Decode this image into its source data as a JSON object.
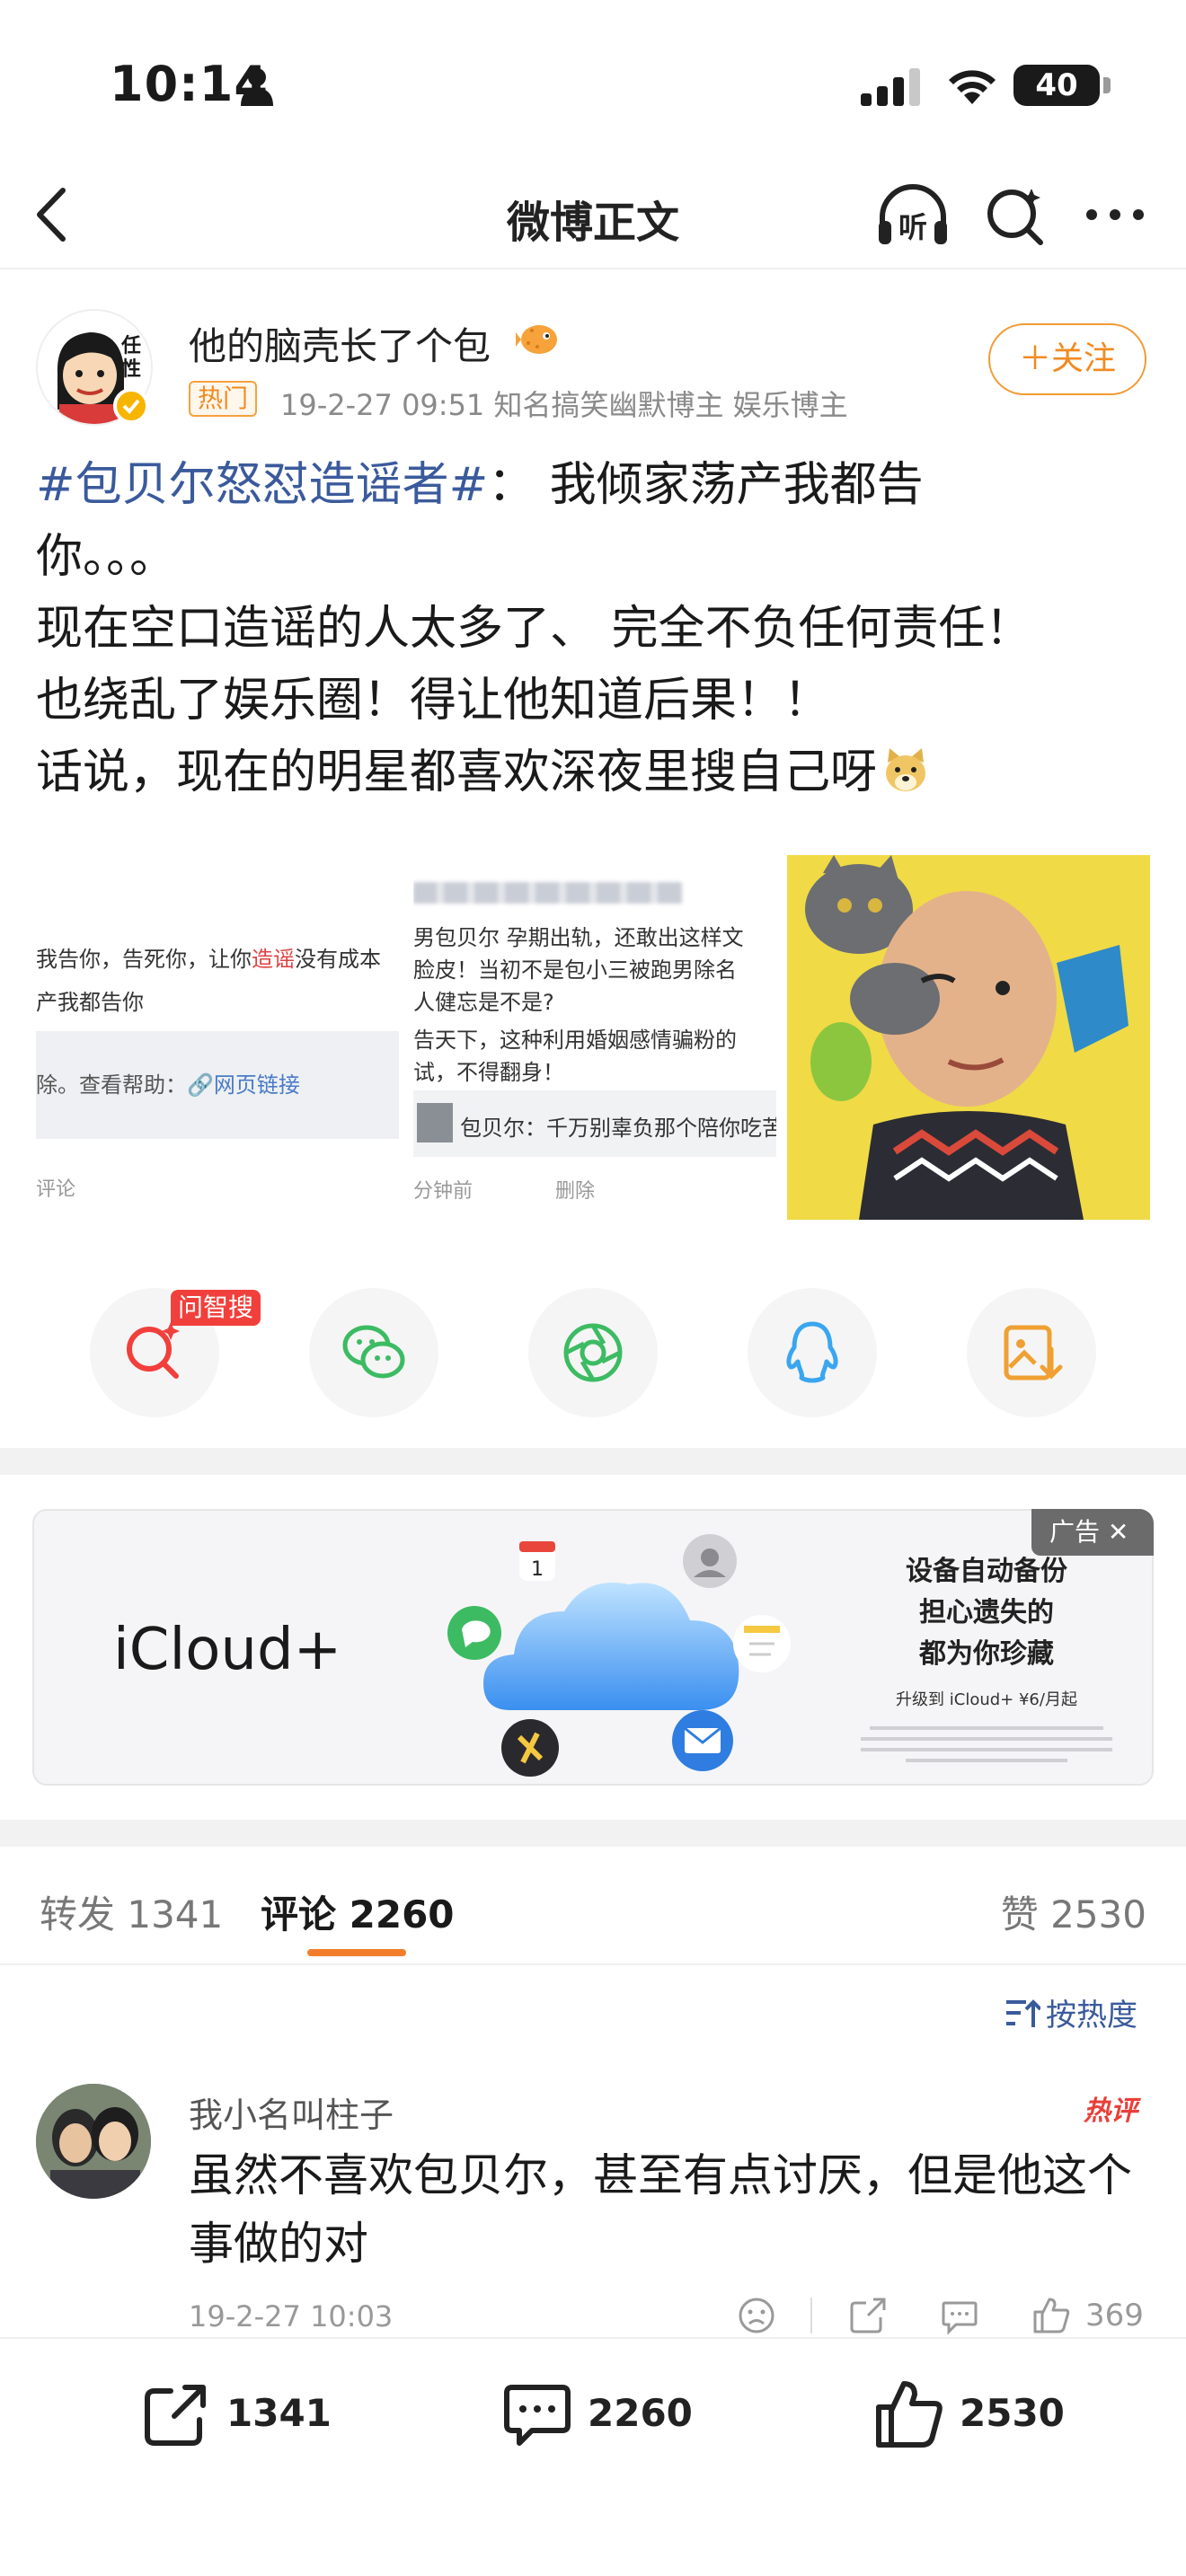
{
  "status_bar": {
    "time": "10:14",
    "battery": "40"
  },
  "nav": {
    "title": "微博正文",
    "listen_label": "听"
  },
  "post": {
    "author": "他的脑壳长了个包",
    "hot_tag": "热门",
    "meta": "19-2-27 09:51  知名搞笑幽默博主 娱乐博主",
    "follow_label": "＋关注",
    "hashtag": "#包贝尔怒怼造谣者#",
    "lines": [
      "：  我倾家荡产我都告",
      "你。。。",
      "现在空口造谣的人太多了、 完全不负任何责任！",
      "也绕乱了娱乐圈！得让他知道后果！！",
      "话说，现在的明星都喜欢深夜里搜自己呀"
    ],
    "image1": {
      "line1a": "我告你，告死你，让你",
      "line1b": "造谣",
      "line1c": "没有成本",
      "line2": "产我都告你",
      "line3a": "除。查看帮助：",
      "line3b": "🔗网页链接",
      "line4": "评论"
    },
    "image2": {
      "line1": "男包贝尔 孕期出轨，还敢出这样文",
      "line2": "脸皮！当初不是包小三被跑男除名",
      "line3": "人健忘是不是?",
      "line4": "告天下，这种利用婚姻感情骗粉的",
      "line5": "试，不得翻身！",
      "line6": "包贝尔：千万别辜负那个陪你吃苦",
      "line7a": "分钟前",
      "line7b": "删除"
    }
  },
  "share": {
    "wenzhisou_badge": "问智搜"
  },
  "ad": {
    "brand": "iCloud+",
    "label": "广告 ✕",
    "line1": "设备自动备份",
    "line2": "担心遗失的",
    "line3": "都为你珍藏",
    "price": "升级到 iCloud+ ¥6/月起",
    "calendar_day": "1"
  },
  "tabs": {
    "repost": "转发 1341",
    "comment": "评论 2260",
    "like": "赞 2530"
  },
  "sort": {
    "label": "按热度"
  },
  "comment": {
    "author": "我小名叫柱子",
    "hot_badge": "热评",
    "text": "虽然不喜欢包贝尔，甚至有点讨厌，但是他这个事做的对",
    "date": "19-2-27 10:03",
    "likes": "369"
  },
  "bottom_bar": {
    "reposts": "1341",
    "comments": "2260",
    "likes": "2530"
  },
  "colors": {
    "accent_orange": "#f28a20",
    "hashtag_blue": "#3a5a9c",
    "badge_red": "#f1403c"
  }
}
